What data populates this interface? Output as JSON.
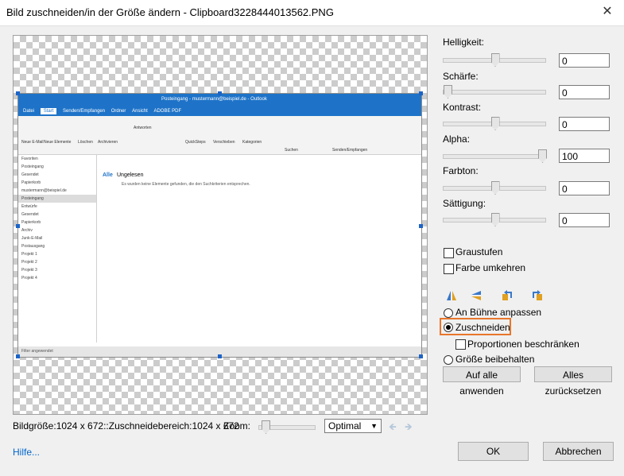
{
  "window": {
    "title": "Bild zuschneiden/in der Größe ändern - Clipboard3228444013562.PNG"
  },
  "adjust": {
    "brightness": {
      "label": "Helligkeit:",
      "value": "0",
      "level": 0.5
    },
    "sharpness": {
      "label": "Schärfe:",
      "value": "0",
      "level": 0.0
    },
    "contrast": {
      "label": "Kontrast:",
      "value": "0",
      "level": 0.5
    },
    "alpha": {
      "label": "Alpha:",
      "value": "100",
      "level": 1.0
    },
    "hue": {
      "label": "Farbton:",
      "value": "0",
      "level": 0.5
    },
    "saturation": {
      "label": "Sättigung:",
      "value": "0",
      "level": 0.5
    }
  },
  "options": {
    "grayscale": "Graustufen",
    "invert": "Farbe umkehren",
    "fit_stage": "An Bühne anpassen",
    "crop": "Zuschneiden",
    "keep_proportions": "Proportionen beschränken",
    "keep_size": "Größe beibehalten",
    "selected": "crop"
  },
  "buttons": {
    "apply_all": "Auf alle anwenden",
    "reset_all": "Alles zurücksetzen",
    "ok": "OK",
    "cancel": "Abbrechen"
  },
  "footer": {
    "info": "Bildgröße:1024 x 672::Zuschneidebereich:1024 x 672",
    "zoom_label": "Zoom:",
    "zoom_value": "Optimal",
    "zoom_level": 0.05,
    "help": "Hilfe..."
  },
  "embedded": {
    "title": "Posteingang - mustermann@beispiel.de - Outlook",
    "tabs": [
      "Datei",
      "Start",
      "Senden/Empfangen",
      "Ordner",
      "Ansicht",
      "ADOBE PDF"
    ],
    "ribbon": [
      "Neue E-Mail",
      "Neue Elemente",
      "Löschen",
      "Archivieren",
      "Antworten",
      "QuickSteps",
      "Verschieben",
      "Kategorien",
      "Suchen",
      "Senden/Empfangen"
    ],
    "folders": [
      "Favoriten",
      "Posteingang",
      "Gesendet",
      "Papierkorb",
      "mustermann@beispiel.de",
      "Posteingang",
      "Entwürfe",
      "Gesendet",
      "Papierkorb",
      "Archiv",
      "Junk-E-Mail",
      "Postausgang",
      "Projekt 1",
      "Projekt 2",
      "Projekt 3",
      "Projekt 4"
    ],
    "filter_all": "Alle",
    "filter_unread": "Ungelesen",
    "empty_msg": "Es wurden keine Elemente gefunden, die den Suchkriterien entsprechen.",
    "status": "Filter angewendet"
  }
}
